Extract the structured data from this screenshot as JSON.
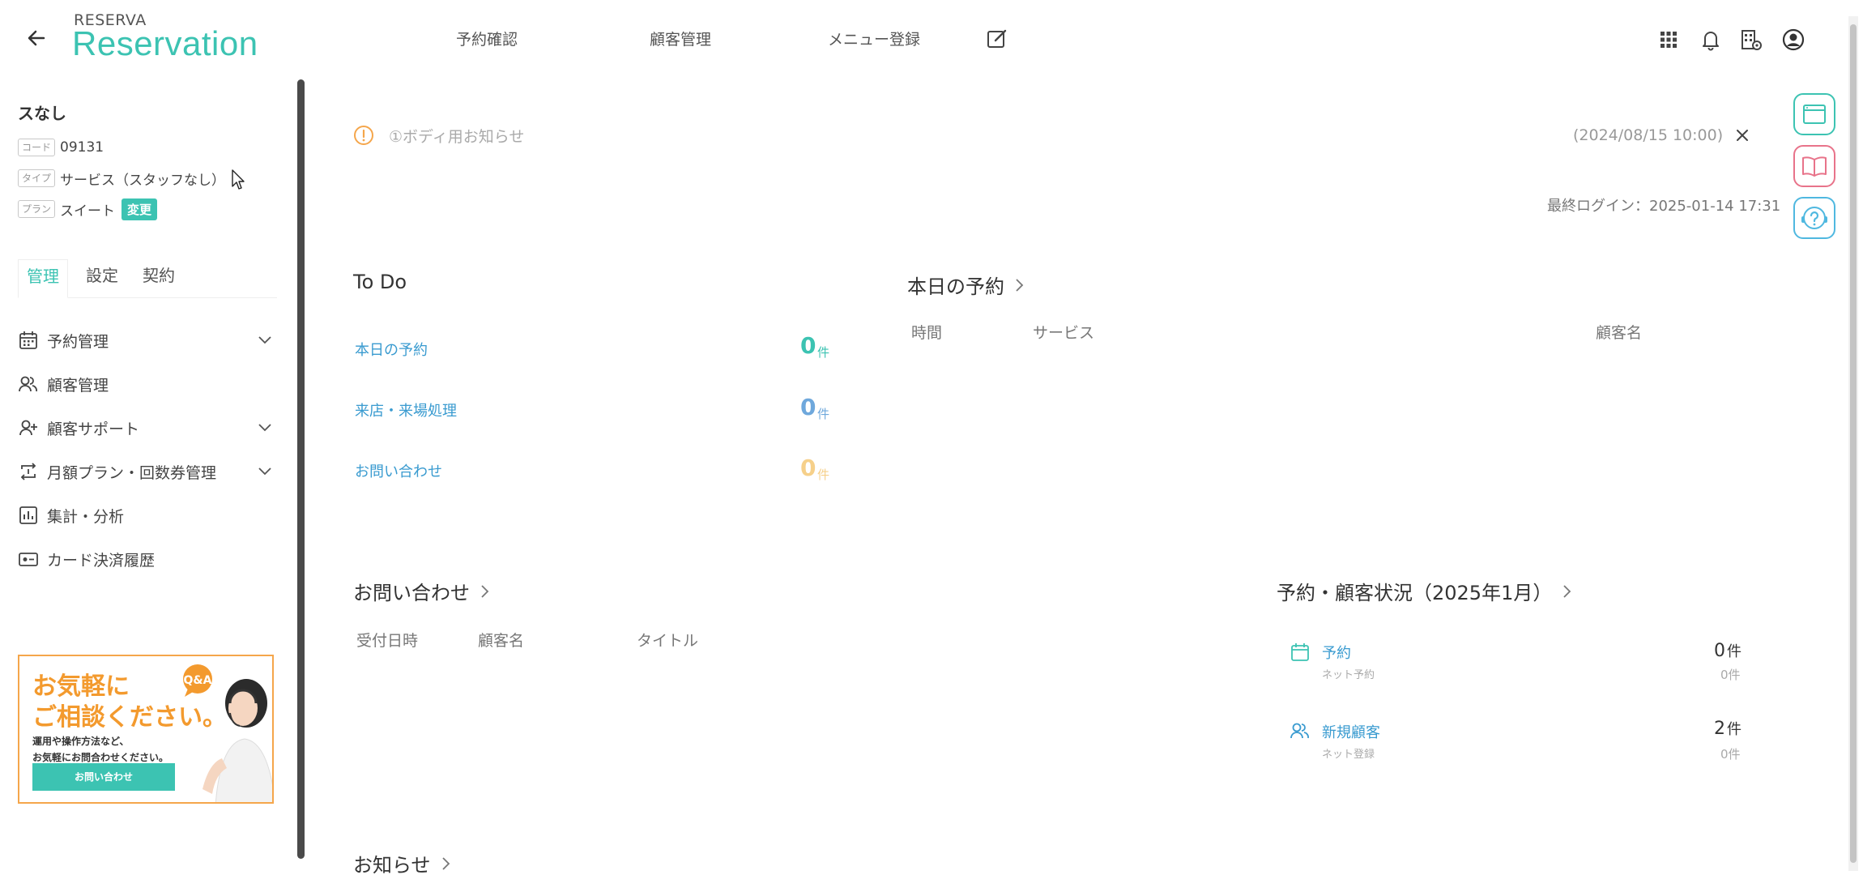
{
  "header": {
    "brand_small": "RESERVA",
    "brand_big": "Reservation",
    "nav": [
      "予約確認",
      "顧客管理",
      "メニュー登録"
    ]
  },
  "sidebar": {
    "store_name": "スなし",
    "info": [
      {
        "tag": "コード",
        "value": "09131"
      },
      {
        "tag": "タイプ",
        "value": "サービス（スタッフなし）"
      },
      {
        "tag": "プラン",
        "value": "スイート"
      }
    ],
    "change_label": "変更",
    "tabs": [
      "管理",
      "設定",
      "契約"
    ],
    "menu": [
      {
        "label": "予約管理",
        "icon": "calendar-icon",
        "expandable": true
      },
      {
        "label": "顧客管理",
        "icon": "users-icon",
        "expandable": false
      },
      {
        "label": "顧客サポート",
        "icon": "user-plus-icon",
        "expandable": true
      },
      {
        "label": "月額プラン・回数券管理",
        "icon": "repeat-icon",
        "expandable": true
      },
      {
        "label": "集計・分析",
        "icon": "bar-chart-icon",
        "expandable": false
      },
      {
        "label": "カード決済履歴",
        "icon": "card-icon",
        "expandable": false
      }
    ],
    "banner": {
      "title_line1": "お気軽に",
      "title_line2": "ご相談ください。",
      "sub_line1": "運用や操作方法など、",
      "sub_line2": "お気軽にお問合わせください。",
      "button": "お問い合わせ",
      "bubble": "Q&A"
    }
  },
  "notice": {
    "text": "①ボディ用お知らせ",
    "date": "(2024/08/15 10:00)"
  },
  "last_login": "最終ログイン：2025-01-14 17:31",
  "todo": {
    "title": "To Do",
    "items": [
      {
        "label": "本日の予約",
        "count": "0",
        "unit": "件",
        "color": "#3cc3b2"
      },
      {
        "label": "来店・来場処理",
        "count": "0",
        "unit": "件",
        "color": "#6fa8dc"
      },
      {
        "label": "お問い合わせ",
        "count": "0",
        "unit": "件",
        "color": "#f6d08a"
      }
    ]
  },
  "today_reservations": {
    "title": "本日の予約",
    "columns": [
      "時間",
      "サービス",
      "顧客名"
    ]
  },
  "inquiries": {
    "title": "お問い合わせ",
    "columns": [
      "受付日時",
      "顧客名",
      "タイトル"
    ]
  },
  "status": {
    "title": "予約・顧客状況（2025年1月）",
    "rows": [
      {
        "label": "予約",
        "sub": "ネット予約",
        "count": "0",
        "unit": "件",
        "subcount": "0件",
        "icon": "calendar-icon"
      },
      {
        "label": "新規顧客",
        "sub": "ネット登録",
        "count": "2",
        "unit": "件",
        "subcount": "0件",
        "icon": "users-icon"
      }
    ]
  },
  "news": {
    "title": "お知らせ"
  },
  "colors": {
    "accent": "#3cc3b2",
    "link": "#3a9bd0",
    "warning": "#f39a2e",
    "book": "#e8738a",
    "help": "#4fb8e0"
  }
}
